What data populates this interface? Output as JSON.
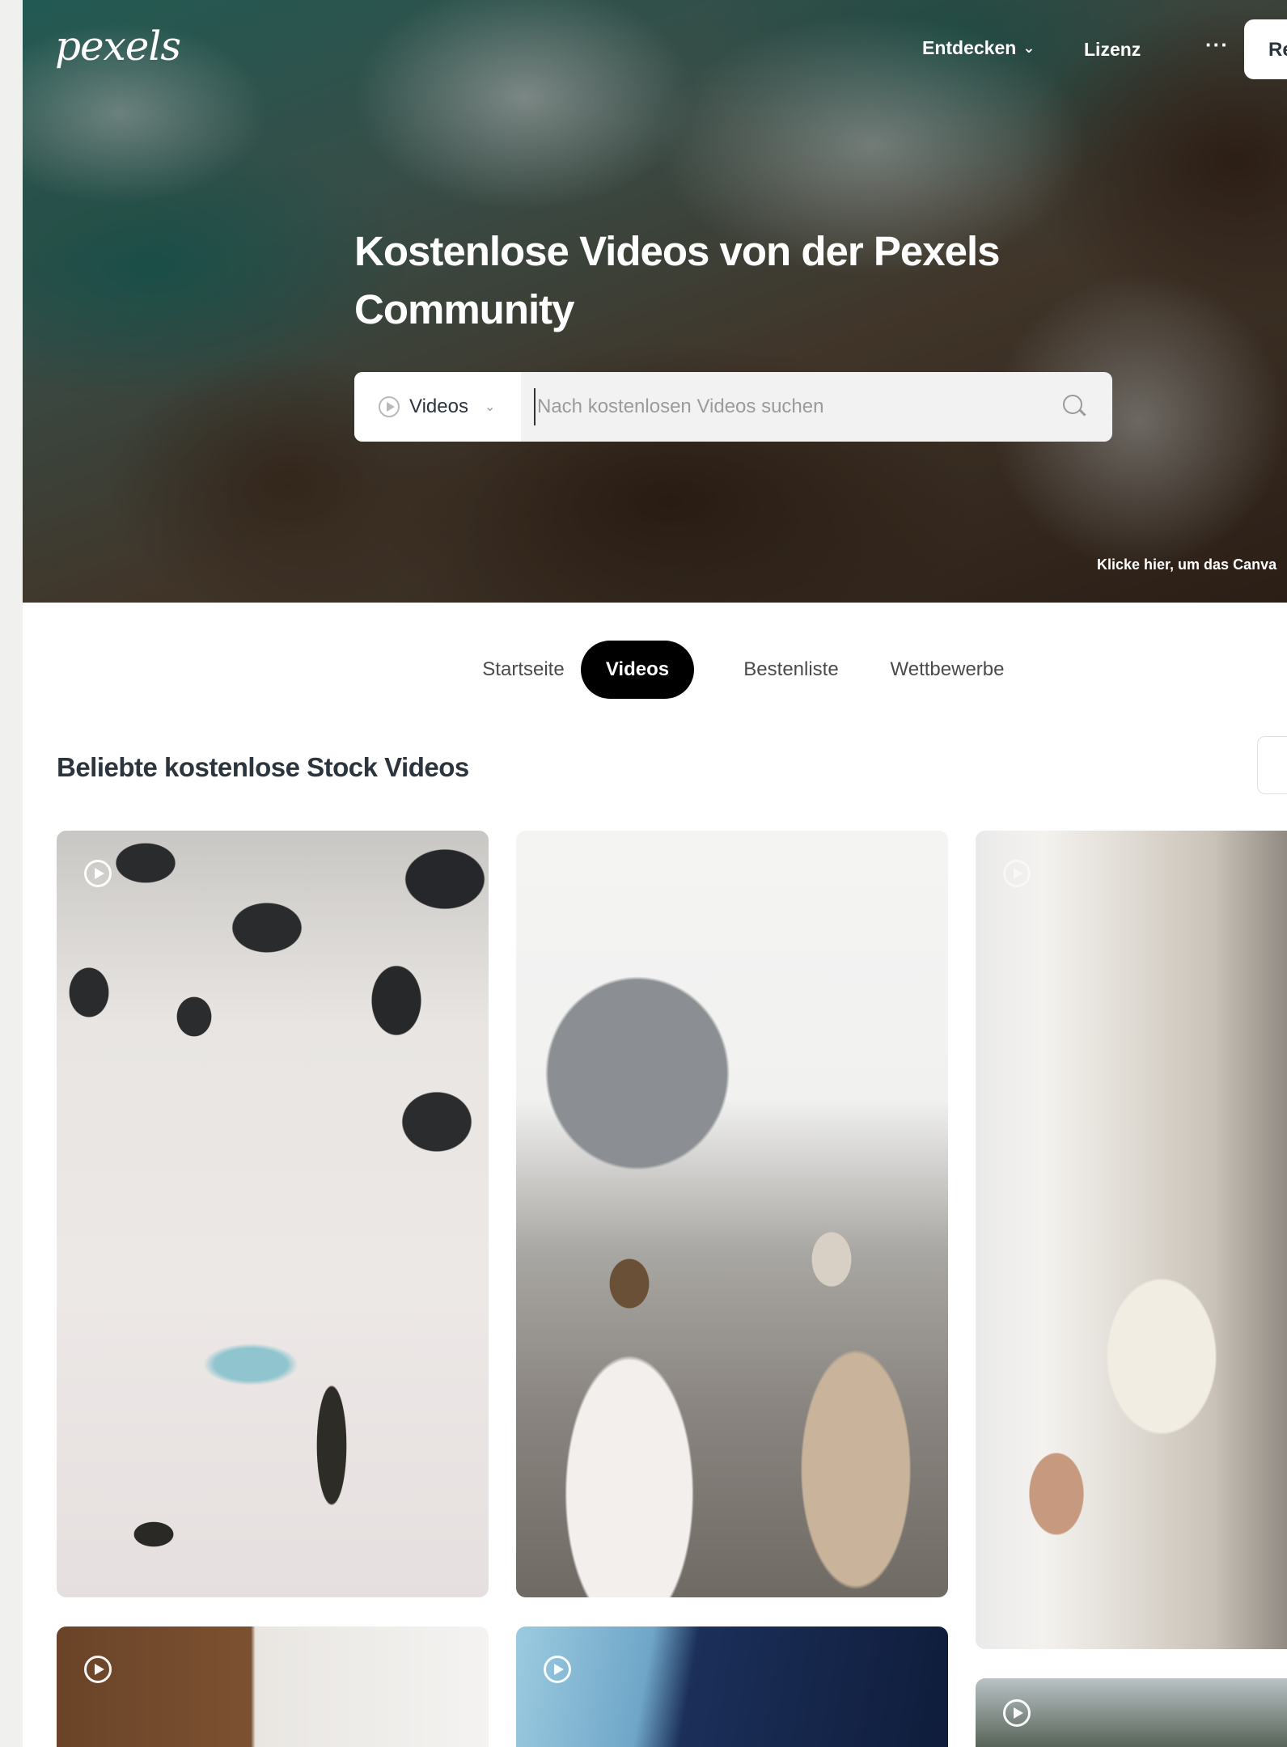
{
  "header": {
    "logo": "pexels",
    "nav": {
      "explore_label": "Entdecken",
      "license_label": "Lizenz",
      "more_label": "···",
      "join_label": "Re"
    }
  },
  "hero": {
    "title": "Kostenlose Videos von der Pexels Community",
    "search": {
      "type_label": "Videos",
      "placeholder": "Nach kostenlosen Videos suchen"
    },
    "canva_note": "Klicke hier, um das Canva"
  },
  "tabs": [
    {
      "label": "Startseite",
      "active": false
    },
    {
      "label": "Videos",
      "active": true
    },
    {
      "label": "Bestenliste",
      "active": false
    },
    {
      "label": "Wettbewerbe",
      "active": false
    }
  ],
  "section": {
    "title": "Beliebte kostenlose Stock Videos"
  },
  "grid": {
    "items": [
      {
        "name": "video-snowy-mountain",
        "icon": "play-icon"
      },
      {
        "name": "video-mosque-women",
        "icon": "none"
      },
      {
        "name": "video-reading-book",
        "icon": "play-icon"
      },
      {
        "name": "video-wooden-door",
        "icon": "play-icon"
      },
      {
        "name": "video-sky",
        "icon": "play-icon"
      },
      {
        "name": "video-trees",
        "icon": "play-icon"
      }
    ]
  },
  "colors": {
    "tab_active_bg": "#000000",
    "page_bg": "#ffffff",
    "text": "#2c343e"
  }
}
